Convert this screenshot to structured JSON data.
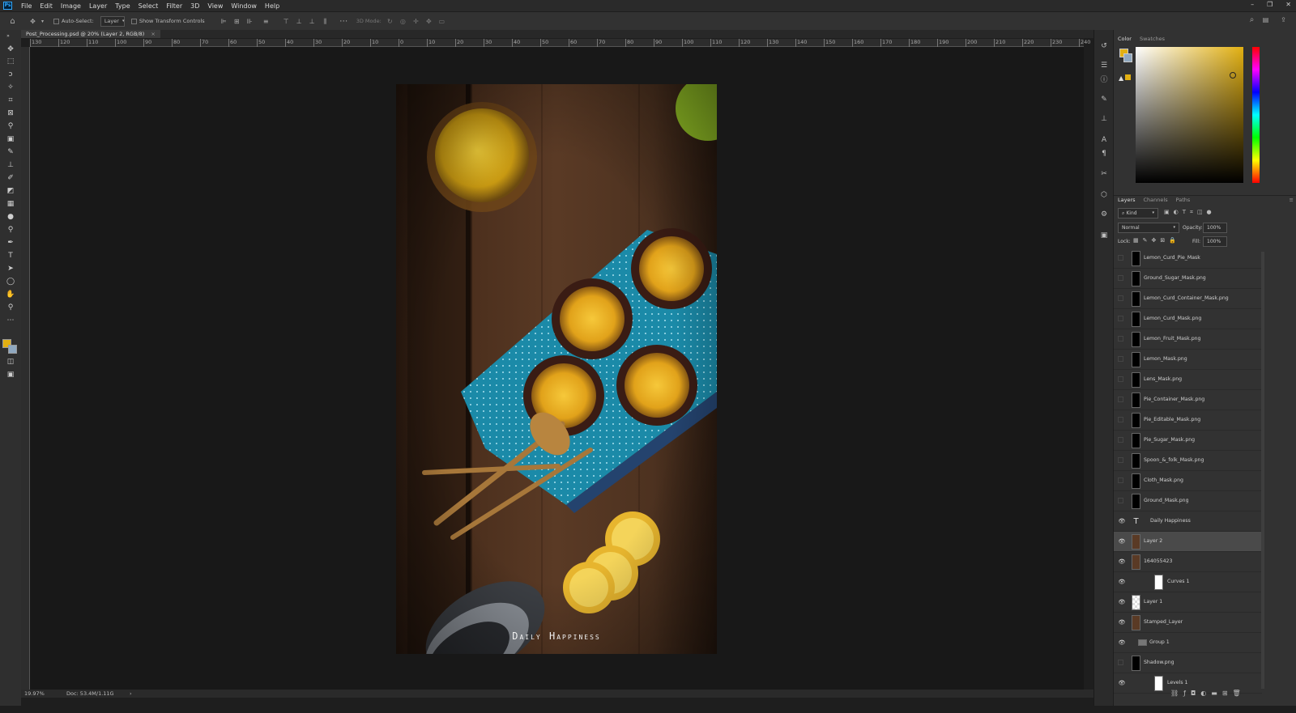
{
  "menubar": {
    "items": [
      "File",
      "Edit",
      "Image",
      "Layer",
      "Type",
      "Select",
      "Filter",
      "3D",
      "View",
      "Window",
      "Help"
    ],
    "logo": "Ps"
  },
  "options": {
    "auto_select_label": "Auto-Select:",
    "auto_select_target": "Layer",
    "show_transform_label": "Show Transform Controls",
    "mode_3d_label": "3D Mode:"
  },
  "document": {
    "tab_title": "Post_Processing.psd @ 20% (Layer 2, RGB/8)",
    "tab_close": "×",
    "zoom": "19.97%",
    "doc_info": "Doc: 53.4M/1.11G",
    "status_arrow": "›"
  },
  "ruler": {
    "labels": [
      "130",
      "120",
      "110",
      "100",
      "90",
      "80",
      "70",
      "60",
      "50",
      "40",
      "30",
      "20",
      "10",
      "0",
      "10",
      "20",
      "30",
      "40",
      "50",
      "60",
      "70",
      "80",
      "90",
      "100",
      "110",
      "120",
      "130",
      "140",
      "150",
      "160",
      "170",
      "180",
      "190",
      "200",
      "210",
      "220",
      "230",
      "240"
    ]
  },
  "artwork": {
    "caption": "Daily Happiness"
  },
  "color_panel": {
    "tabs": [
      "Color",
      "Swatches"
    ],
    "fg_color": "#e2b012",
    "bg_color": "#8fa8c0"
  },
  "layers_panel": {
    "tabs": [
      "Layers",
      "Channels",
      "Paths"
    ],
    "filter_kind": "Kind",
    "blend_mode": "Normal",
    "opacity_label": "Opacity:",
    "opacity_value": "100%",
    "lock_label": "Lock:",
    "fill_label": "Fill:",
    "fill_value": "100%",
    "layers": [
      {
        "name": "Lemon_Curd_Pie_Mask",
        "visible": false
      },
      {
        "name": "Ground_Sugar_Mask.png",
        "visible": false
      },
      {
        "name": "Lemon_Curd_Container_Mask.png",
        "visible": false
      },
      {
        "name": "Lemon_Curd_Mask.png",
        "visible": false
      },
      {
        "name": "Lemon_Fruit_Mask.png",
        "visible": false
      },
      {
        "name": "Lemon_Mask.png",
        "visible": false
      },
      {
        "name": "Lens_Mask.png",
        "visible": false
      },
      {
        "name": "Pie_Container_Mask.png",
        "visible": false
      },
      {
        "name": "Pie_Editable_Mask.png",
        "visible": false
      },
      {
        "name": "Pie_Sugar_Mask.png",
        "visible": false
      },
      {
        "name": "Spoon_&_folk_Mask.png",
        "visible": false
      },
      {
        "name": "Cloth_Mask.png",
        "visible": false
      },
      {
        "name": "Ground_Mask.png",
        "visible": false
      },
      {
        "name": "Daily Happiness",
        "visible": true,
        "type": "text"
      },
      {
        "name": "Layer 2",
        "visible": true,
        "selected": true
      },
      {
        "name": "164055423",
        "visible": true
      },
      {
        "name": "Curves 1",
        "visible": true,
        "type": "adjustment"
      },
      {
        "name": "Layer 1",
        "visible": true
      },
      {
        "name": "Stamped_Layer",
        "visible": true
      },
      {
        "name": "Group 1",
        "visible": true,
        "type": "group"
      },
      {
        "name": "Shadow.png",
        "visible": false
      },
      {
        "name": "Levels 1",
        "visible": true,
        "type": "adjustment"
      }
    ]
  },
  "icons": {
    "eye": "eye-icon",
    "text_layer": "T"
  }
}
